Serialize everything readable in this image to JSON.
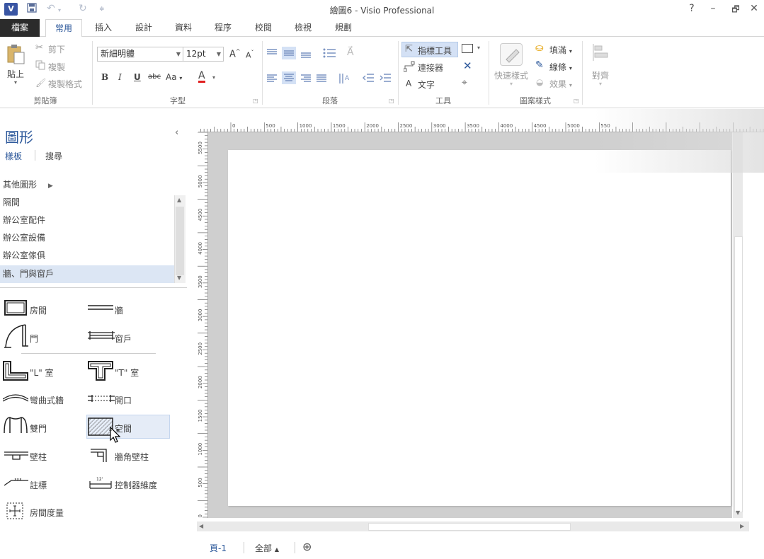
{
  "titlebar": {
    "app_icon": "V",
    "title": "繪圖6 - Visio Professional",
    "help": "?",
    "minimize": "–",
    "restore": "🗗",
    "close": "✕"
  },
  "tabs": {
    "file": "檔案",
    "items": [
      "常用",
      "插入",
      "設計",
      "資料",
      "程序",
      "校閱",
      "檢視",
      "規劃"
    ]
  },
  "ribbon": {
    "clipboard": {
      "paste": "貼上",
      "cut": "剪下",
      "copy": "複製",
      "format_painter": "複製格式",
      "label": "剪貼簿"
    },
    "font": {
      "font_name": "新細明體",
      "font_size": "12pt",
      "grow": "A",
      "shrink": "A",
      "bold": "B",
      "italic": "I",
      "underline": "U",
      "strike": "abc",
      "case": "Aa",
      "color": "A",
      "label": "字型"
    },
    "paragraph": {
      "label": "段落"
    },
    "tools": {
      "pointer": "指標工具",
      "connector": "連接器",
      "text": "文字",
      "label": "工具"
    },
    "shape_styles": {
      "quick_styles": "快速樣式",
      "fill": "填滿",
      "line": "線條",
      "effects": "效果",
      "label": "圖案樣式"
    },
    "arrange": {
      "align": "對齊"
    }
  },
  "shapes_panel": {
    "title": "圖形",
    "tab_stencils": "樣板",
    "tab_search": "搜尋",
    "more_shapes": "其他圖形",
    "stencils": [
      "隔間",
      "辦公室配件",
      "辦公室設備",
      "辦公室傢俱",
      "牆、門與窗戶"
    ],
    "shapes": [
      {
        "label": "房間"
      },
      {
        "label": "牆"
      },
      {
        "label": "門"
      },
      {
        "label": "窗戶"
      },
      {
        "label": "\"L\" 室"
      },
      {
        "label": "\"T\" 室"
      },
      {
        "label": "彎曲式牆"
      },
      {
        "label": "開口"
      },
      {
        "label": "雙門"
      },
      {
        "label": "空間"
      },
      {
        "label": "壁柱"
      },
      {
        "label": "牆角壁柱"
      },
      {
        "label": "註標"
      },
      {
        "label": "控制器維度"
      },
      {
        "label": "房間度量"
      }
    ]
  },
  "ruler_top": [
    "0",
    "500",
    "1000",
    "1500",
    "2000",
    "2500",
    "3000",
    "3500",
    "4000",
    "4500",
    "5000",
    "550"
  ],
  "ruler_left": [
    "5500",
    "5000",
    "4500",
    "4000",
    "3500",
    "3000",
    "2500",
    "2000",
    "1500",
    "1000",
    "500",
    "0"
  ],
  "page_tabs": {
    "page": "頁-1",
    "all": "全部",
    "all_arrow": "▲",
    "add": "⊕"
  }
}
